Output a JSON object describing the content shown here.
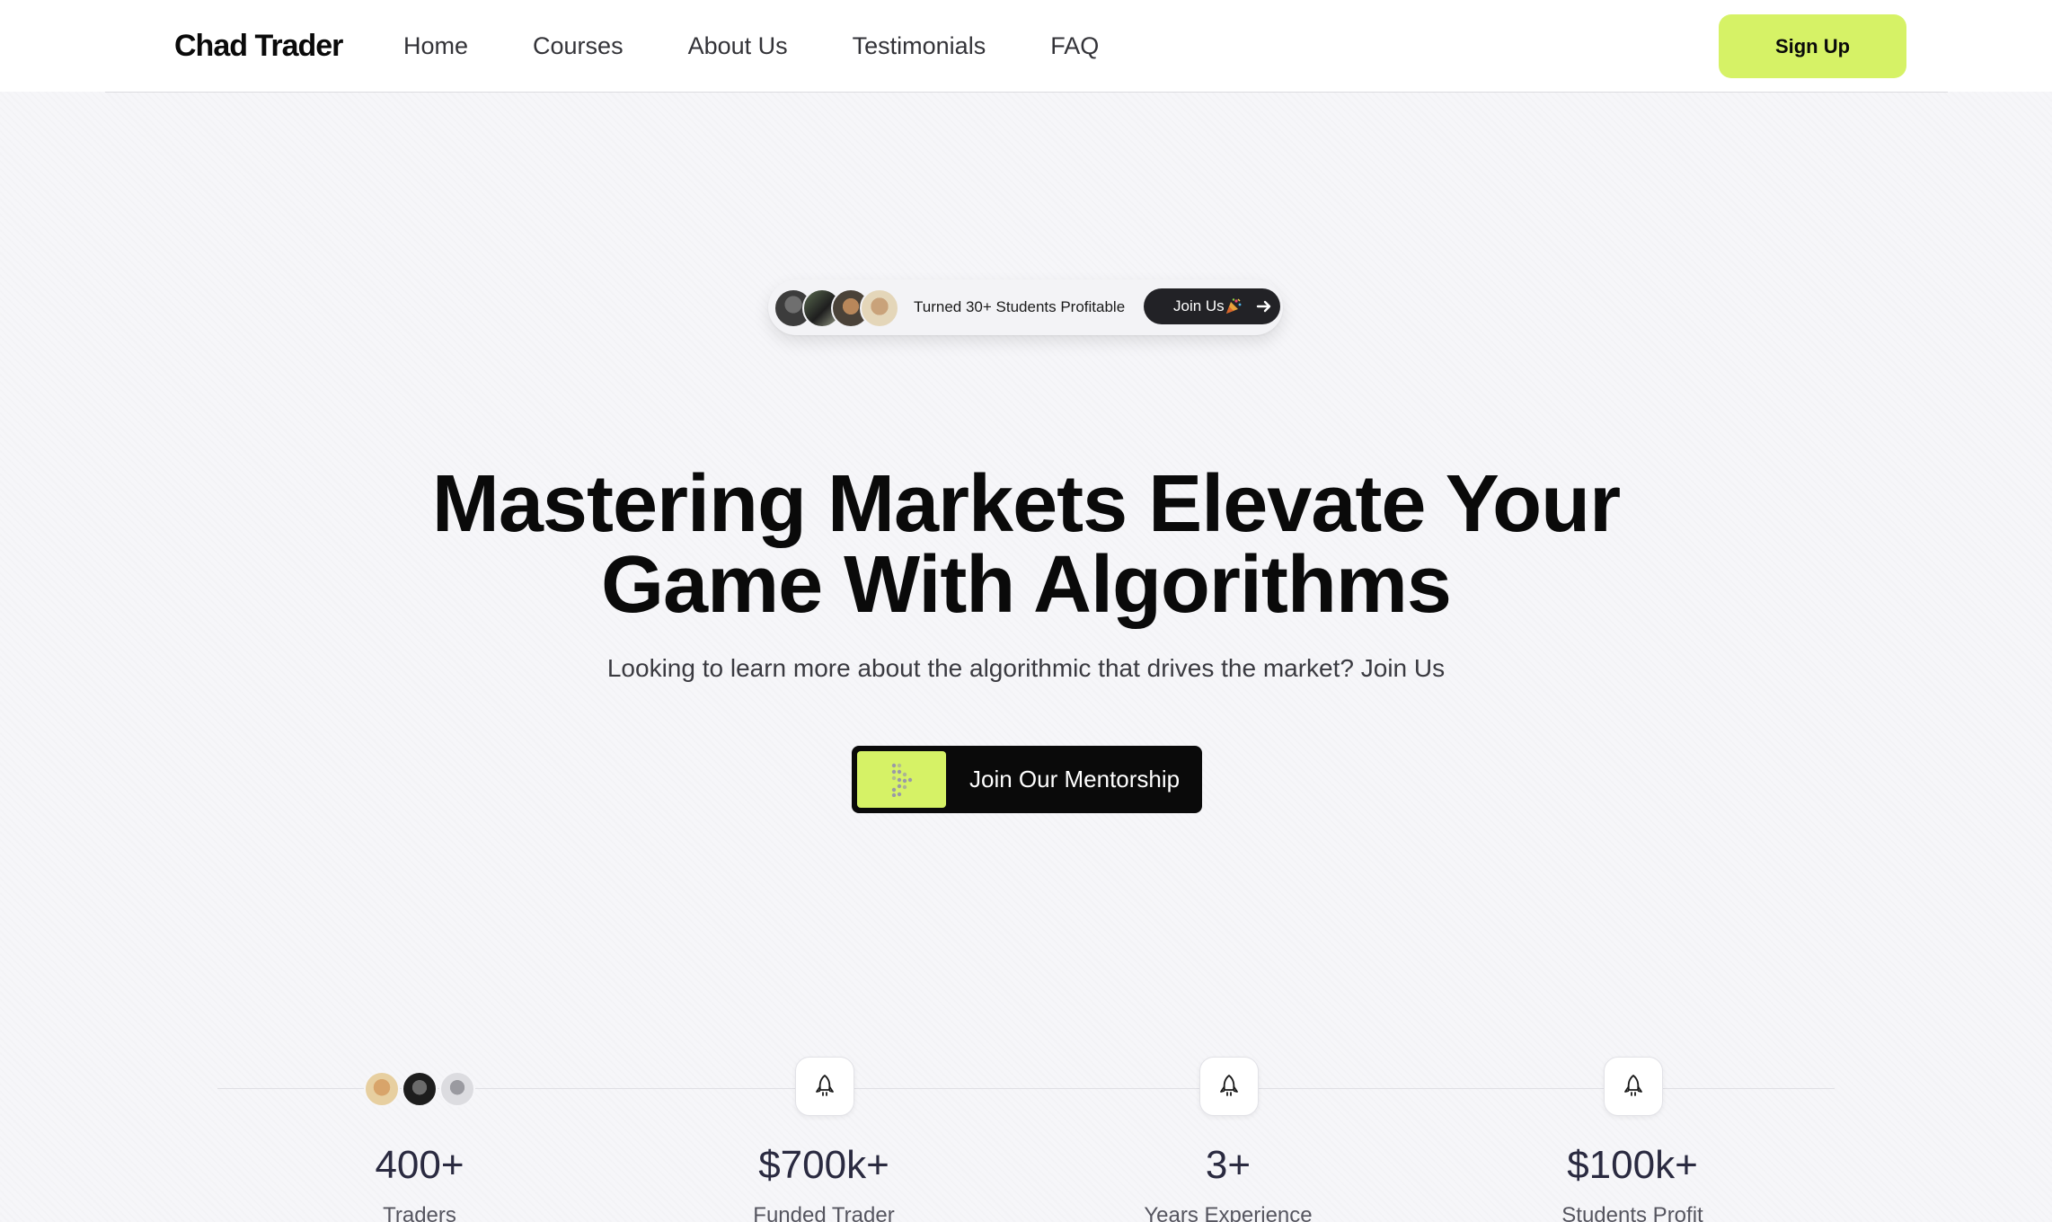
{
  "header": {
    "logo": "Chad Trader",
    "nav": [
      "Home",
      "Courses",
      "About Us",
      "Testimonials",
      "FAQ"
    ],
    "signup_label": "Sign Up"
  },
  "badge": {
    "text": "Turned 30+ Students Profitable",
    "join_label": "Join Us"
  },
  "hero": {
    "title_line1": "Mastering Markets Elevate Your",
    "title_line2": "Game With Algorithms",
    "subtitle": "Looking to learn more about the algorithmic that drives the market? Join Us",
    "cta_label": "Join Our Mentorship"
  },
  "stats": [
    {
      "value": "400+",
      "label": "Traders"
    },
    {
      "value": "$700k+",
      "label": "Funded Trader"
    },
    {
      "value": "3+",
      "label": "Years Experience"
    },
    {
      "value": "$100k+",
      "label": "Students Profit"
    }
  ],
  "colors": {
    "accent": "#d6f266",
    "dark": "#0a0a0a",
    "background": "#f6f6f9"
  }
}
